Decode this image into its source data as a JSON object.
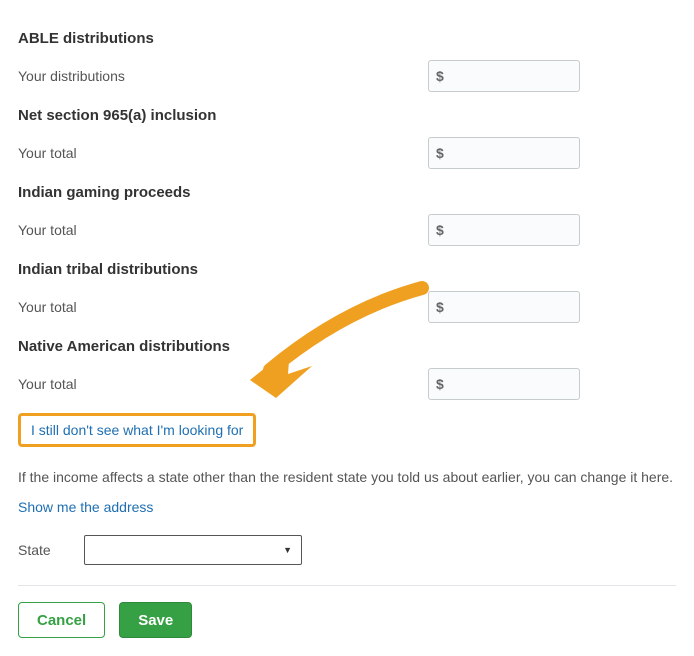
{
  "sections": [
    {
      "title": "ABLE distributions",
      "label": "Your distributions",
      "value": ""
    },
    {
      "title": "Net section 965(a) inclusion",
      "label": "Your total",
      "value": ""
    },
    {
      "title": "Indian gaming proceeds",
      "label": "Your total",
      "value": ""
    },
    {
      "title": "Indian tribal distributions",
      "label": "Your total",
      "value": ""
    },
    {
      "title": "Native American distributions",
      "label": "Your total",
      "value": ""
    }
  ],
  "helpLink": "I still don't see what I'm looking for",
  "stateNote": "If the income affects a state other than the resident state you told us about earlier, you can change it here.",
  "showAddress": "Show me the address",
  "stateLabel": "State",
  "stateValue": "",
  "buttons": {
    "cancel": "Cancel",
    "save": "Save"
  },
  "currencyPrefix": "$"
}
